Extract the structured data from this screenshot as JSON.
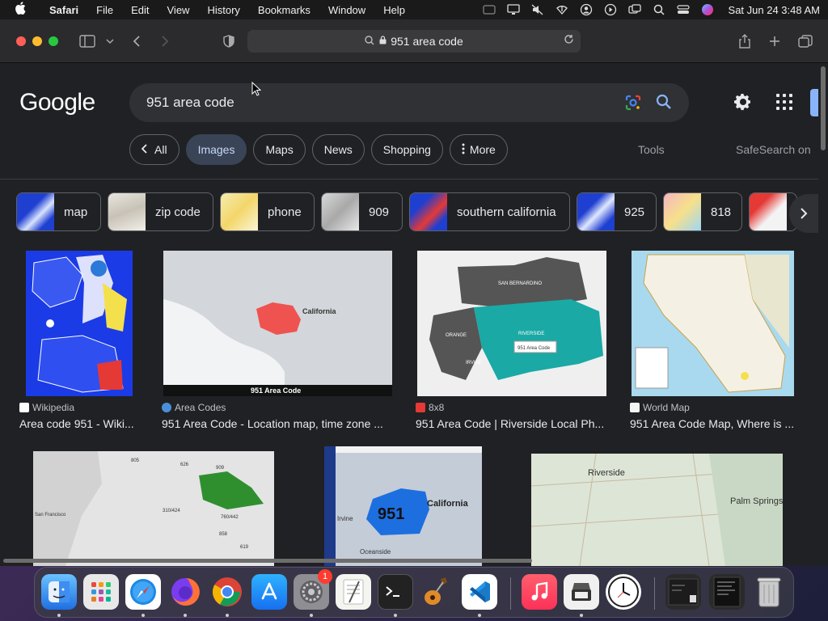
{
  "menubar": {
    "app_name": "Safari",
    "items": [
      "File",
      "Edit",
      "View",
      "History",
      "Bookmarks",
      "Window",
      "Help"
    ],
    "clock": "Sat Jun 24  3:48 AM"
  },
  "browser": {
    "url": "951 area code"
  },
  "google": {
    "logo": "Google",
    "query": "951 area code",
    "tabs": [
      {
        "label": "All",
        "active": false
      },
      {
        "label": "Images",
        "active": true
      },
      {
        "label": "Maps",
        "active": false
      },
      {
        "label": "News",
        "active": false
      },
      {
        "label": "Shopping",
        "active": false
      },
      {
        "label": "More",
        "active": false
      }
    ],
    "tools": "Tools",
    "safesearch": "SafeSearch on",
    "chips": [
      "map",
      "zip code",
      "phone",
      "909",
      "southern california",
      "925",
      "818",
      ""
    ],
    "results": [
      {
        "source": "Wikipedia",
        "title": "Area code 951 - Wiki...",
        "fav_color": "#ffffff"
      },
      {
        "source": "Area Codes",
        "title": "951 Area Code - Location map, time zone ...",
        "fav_color": "#4a90d9",
        "img_caption": "951 Area Code",
        "map_label": "California"
      },
      {
        "source": "8x8",
        "title": "951 Area Code | Riverside Local Ph...",
        "fav_color": "#e53935",
        "map_labels": [
          "SAN BERNARDINO",
          "RIVERSIDE",
          "ORANGE",
          "IRVINE",
          "951 Area Code"
        ]
      },
      {
        "source": "World Map",
        "title": "951 Area Code Map, Where is ...",
        "fav_color": "#f5f5f5"
      },
      {
        "map_labels": [
          "San Francisco",
          "310/424",
          "760/442",
          "858",
          "619",
          "909",
          "626",
          "805"
        ]
      },
      {
        "map_labels": [
          "951",
          "California",
          "Irvine",
          "Oceanside"
        ]
      },
      {
        "map_labels": [
          "Riverside",
          "Palm Springs"
        ]
      }
    ]
  },
  "dock": {
    "settings_badge": "1"
  }
}
